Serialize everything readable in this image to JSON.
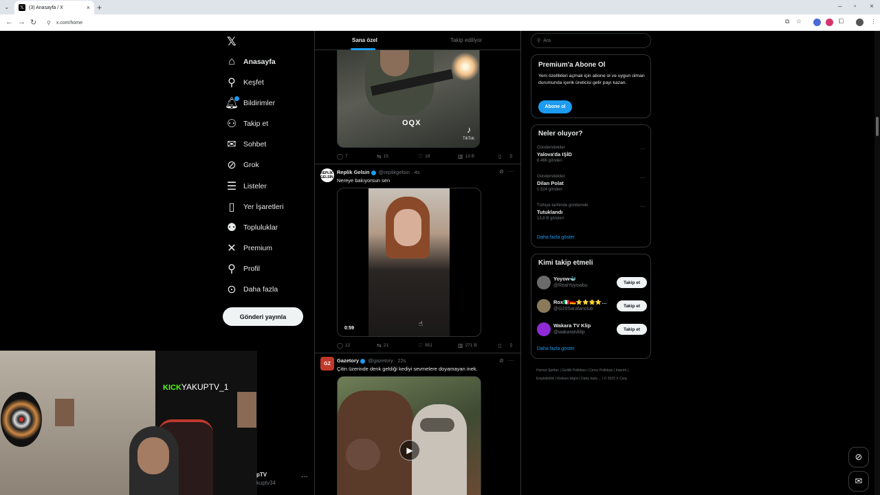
{
  "browser": {
    "tab_title": "(3) Anasayfa / X",
    "url": "x.com/home"
  },
  "nav": {
    "items": [
      {
        "label": "Anasayfa",
        "icon": "home-icon"
      },
      {
        "label": "Keşfet",
        "icon": "search-icon"
      },
      {
        "label": "Bildirimler",
        "icon": "bell-icon"
      },
      {
        "label": "Takip et",
        "icon": "add-user-icon"
      },
      {
        "label": "Sohbet",
        "icon": "mail-icon"
      },
      {
        "label": "Grok",
        "icon": "grok-icon"
      },
      {
        "label": "Listeler",
        "icon": "list-icon"
      },
      {
        "label": "Yer İşaretleri",
        "icon": "bookmark-icon"
      },
      {
        "label": "Topluluklar",
        "icon": "communities-icon"
      },
      {
        "label": "Premium",
        "icon": "x-icon"
      },
      {
        "label": "Profil",
        "icon": "user-icon"
      },
      {
        "label": "Daha fazla",
        "icon": "more-circle-icon"
      }
    ],
    "post_button": "Gönderi yayınla"
  },
  "stream": {
    "kick_brand": "KICK",
    "channel": "YAKUPTV_1"
  },
  "account": {
    "name": "pTV",
    "handle": "kuptv34"
  },
  "timeline": {
    "tabs": [
      "Sana özel",
      "Takip ediliyor"
    ],
    "posts": [
      {
        "overlay_text": "OQX",
        "watermark": "TikTok",
        "stats": {
          "replies": "7",
          "reposts": "15",
          "likes": "18",
          "views": "13 B"
        }
      },
      {
        "name": "Replik Gelsin",
        "handle": "@replikgelsin",
        "time": "4s",
        "avatar_text": "REPLİK GELSİN",
        "text": "Nereye bakıyorsun sen",
        "duration": "0:59",
        "stats": {
          "replies": "12",
          "reposts": "21",
          "likes": "951",
          "views": "271 B"
        }
      },
      {
        "name": "Gazetory",
        "handle": "@gazetory",
        "time": "22s",
        "avatar_text": "GZ",
        "text": "Çitin üzerinde denk geldiği kediyi sevmelere doyamayan inek."
      }
    ]
  },
  "sidebar": {
    "search_placeholder": "Ara",
    "premium": {
      "title": "Premium'a Abone Ol",
      "description": "Yeni özellikleri açmak için abone ol ve uygun olman durumunda içerik üreticisi gelir payı kazan.",
      "button": "Abone ol"
    },
    "trends": {
      "title": "Neler oluyor?",
      "items": [
        {
          "context": "Gündemdekiler",
          "name": "Yalova'da IŞİD",
          "count": "6.466 gönderi"
        },
        {
          "context": "Gündemdekiler",
          "name": "Dilan Polat",
          "count": "1.524 gönderi"
        },
        {
          "context": "Türkiye tarihinde gündemde",
          "name": "Tutuklandı",
          "count": "13,8 B gönderi"
        }
      ],
      "show_more": "Daha fazla göster"
    },
    "who_to_follow": {
      "title": "Kimi takip etmeli",
      "items": [
        {
          "name": "Yoyow🐳",
          "handle": "@RealYoyowbu",
          "button": "Takip et",
          "avatar_color": "#6b6b6b"
        },
        {
          "name": "Rox🇮🇹🇩🇪⭐⭐🌟⭐…",
          "handle": "@G20Sarafanclub",
          "button": "Takip et",
          "avatar_color": "#8a7a5a"
        },
        {
          "name": "Wakara TV Klip",
          "handle": "@wakaratvklip",
          "button": "Takip et",
          "avatar_color": "#8e2bd6"
        }
      ],
      "show_more": "Daha fazla göster"
    },
    "footer": [
      "Hizmet Şartları",
      "Gizlilik Politikası",
      "Çerez Politikası",
      "Imprint",
      "Erişilebilirlik",
      "Reklam bilgisi",
      "Daha fazla ...",
      "© 2025 X Corp."
    ]
  }
}
